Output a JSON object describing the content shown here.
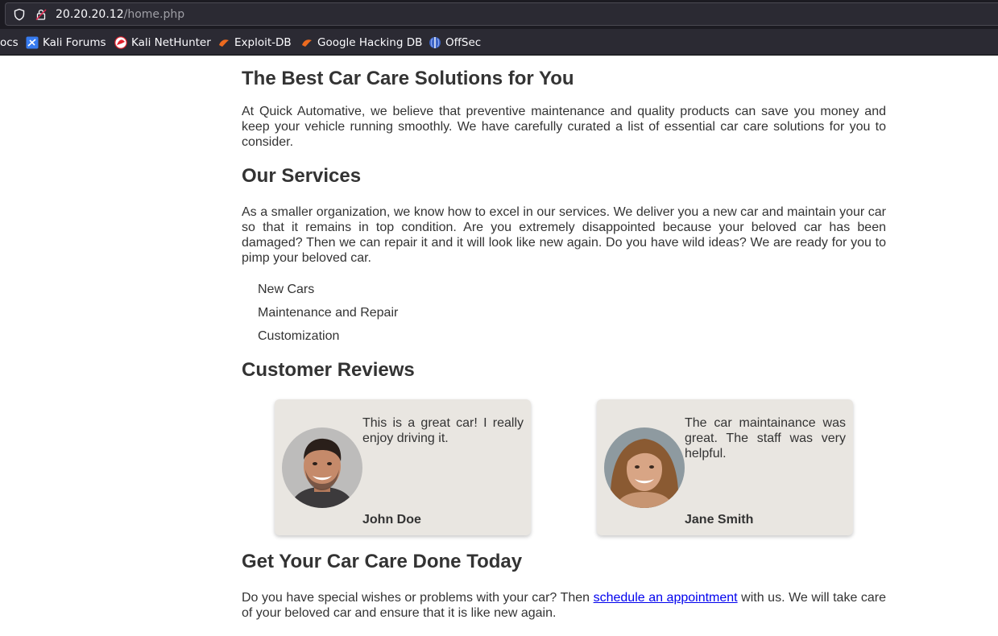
{
  "browser": {
    "url_host": "20.20.20.12",
    "url_path": "/home.php",
    "bookmarks": [
      {
        "label": "ocs",
        "icon": "truncated-bookmark"
      },
      {
        "label": "Kali Forums",
        "icon": "kali-forums-icon"
      },
      {
        "label": "Kali NetHunter",
        "icon": "kali-nethunter-icon"
      },
      {
        "label": "Exploit-DB",
        "icon": "exploit-db-icon"
      },
      {
        "label": "Google Hacking DB",
        "icon": "ghdb-icon"
      },
      {
        "label": "OffSec",
        "icon": "offsec-icon"
      }
    ]
  },
  "page": {
    "hero_title": "The Best Car Care Solutions for You",
    "hero_text": "At Quick Automative, we believe that preventive maintenance and quality products can save you money and keep your vehicle running smoothly. We have carefully curated a list of essential car care solutions for you to consider.",
    "services_title": "Our Services",
    "services_text": "As a smaller organization, we know how to excel in our services. We deliver you a new car and maintain your car so that it remains in top condition. Are you extremely disappointed because your beloved car has been damaged? Then we can repair it and it will look like new again. Do you have wild ideas? We are ready for you to pimp your beloved car.",
    "services": [
      "New Cars",
      "Maintenance and Repair",
      "Customization"
    ],
    "reviews_title": "Customer Reviews",
    "reviews": [
      {
        "text": "This is a great car! I really enjoy driving it.",
        "name": "John Doe"
      },
      {
        "text": "The car maintainance was great. The staff was very helpful.",
        "name": "Jane Smith"
      }
    ],
    "cta_title": "Get Your Car Care Done Today",
    "cta_text_before": "Do you have special wishes or problems with your car? Then ",
    "cta_link": "schedule an appointment",
    "cta_text_after": " with us. We will take care of your beloved car and ensure that it is like new again."
  },
  "colors": {
    "chrome_dark": "#1c1b22",
    "toolbar": "#2b2a33",
    "card_bg": "#e9e6e1",
    "link": "#0000ee"
  }
}
